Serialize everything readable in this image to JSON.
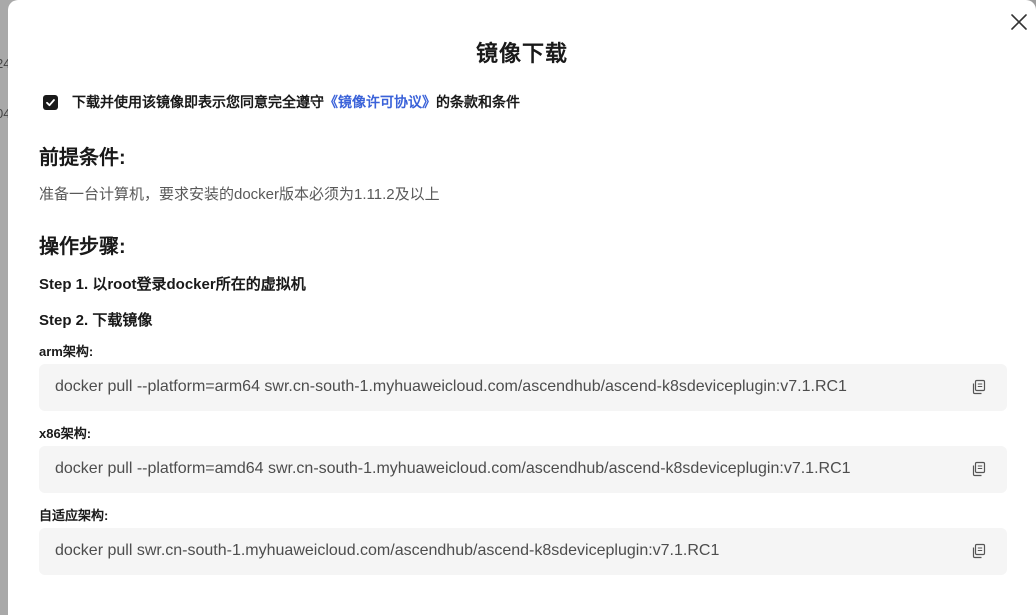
{
  "background": {
    "chars": [
      "24",
      "04"
    ]
  },
  "dialog": {
    "title": "镜像下载",
    "agreement": {
      "checked": true,
      "prefix": "下载并使用该镜像即表示您同意完全遵守",
      "link": "《镜像许可协议》",
      "suffix": "的条款和条件"
    },
    "prerequisites": {
      "heading": "前提条件:",
      "text": "准备一台计算机，要求安装的docker版本必须为1.11.2及以上"
    },
    "steps": {
      "heading": "操作步骤:",
      "step1": "Step 1. 以root登录docker所在的虚拟机",
      "step2": "Step 2. 下载镜像",
      "commands": [
        {
          "label": "arm架构:",
          "command": "docker pull --platform=arm64 swr.cn-south-1.myhuaweicloud.com/ascendhub/ascend-k8sdeviceplugin:v7.1.RC1"
        },
        {
          "label": "x86架构:",
          "command": "docker pull --platform=amd64 swr.cn-south-1.myhuaweicloud.com/ascendhub/ascend-k8sdeviceplugin:v7.1.RC1"
        },
        {
          "label": "自适应架构:",
          "command": "docker pull swr.cn-south-1.myhuaweicloud.com/ascendhub/ascend-k8sdeviceplugin:v7.1.RC1"
        }
      ]
    }
  },
  "icons": {
    "close": "close-icon",
    "checkbox": "checkmark-icon",
    "copy": "copy-icon"
  },
  "colors": {
    "link": "#3a62d9",
    "text": "#191919",
    "muted": "#595959",
    "codeBg": "#f5f5f5"
  }
}
